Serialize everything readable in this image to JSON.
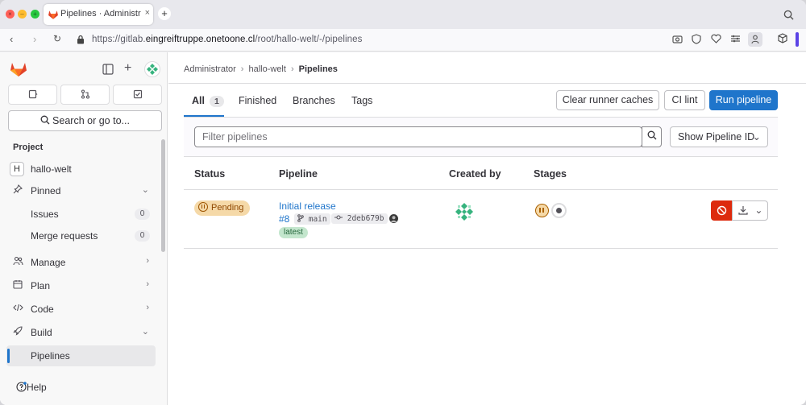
{
  "browser": {
    "tab_title": "Pipelines · Administrator",
    "url_prefix": "https://gitlab.",
    "url_domain": "eingreiftruppe.onetoone.cl",
    "url_path": "/root/hallo-welt/-/pipelines"
  },
  "sidebar": {
    "search_label": "Search or go to...",
    "section_label": "Project",
    "project": {
      "initial": "H",
      "name": "hallo-welt"
    },
    "pinned_label": "Pinned",
    "pinned_items": [
      {
        "label": "Issues",
        "count": "0"
      },
      {
        "label": "Merge requests",
        "count": "0"
      }
    ],
    "nav_items": [
      {
        "label": "Manage"
      },
      {
        "label": "Plan"
      },
      {
        "label": "Code"
      },
      {
        "label": "Build"
      }
    ],
    "build_sub_active": "Pipelines",
    "help_label": "Help"
  },
  "breadcrumb": [
    "Administrator",
    "hallo-welt",
    "Pipelines"
  ],
  "tabs": [
    {
      "label": "All",
      "count": "1",
      "active": true
    },
    {
      "label": "Finished"
    },
    {
      "label": "Branches"
    },
    {
      "label": "Tags"
    }
  ],
  "actions": {
    "clear_caches": "Clear runner caches",
    "ci_lint": "CI lint",
    "run_pipeline": "Run pipeline"
  },
  "filter": {
    "placeholder": "Filter pipelines",
    "show_id": "Show Pipeline ID"
  },
  "table": {
    "headers": [
      "Status",
      "Pipeline",
      "Created by",
      "Stages"
    ],
    "rows": [
      {
        "status": "Pending",
        "title": "Initial release",
        "id": "#8",
        "branch": "main",
        "commit": "2deb679b",
        "tag": "latest"
      }
    ]
  },
  "colors": {
    "primary": "#1f75cb",
    "danger": "#dd2b0e",
    "pending_bg": "#f5d9a8",
    "brand": "#e24329"
  }
}
